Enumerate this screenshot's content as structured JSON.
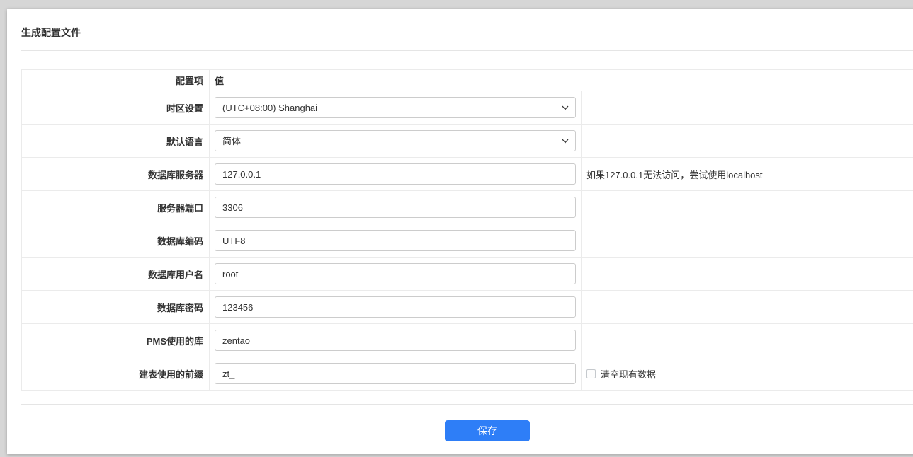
{
  "page": {
    "title": "生成配置文件"
  },
  "colors": {
    "primary_button": "#2e7ef7",
    "page_background": "#d6d6d6",
    "table_border": "#ebebeb",
    "input_border": "#cccccc",
    "text": "#333333"
  },
  "table": {
    "header": {
      "config_item": "配置项",
      "value": "值"
    },
    "rows": [
      {
        "label": "时区设置",
        "control": "select",
        "value": "(UTC+08:00) Shanghai"
      },
      {
        "label": "默认语言",
        "control": "select",
        "value": "简体"
      },
      {
        "label": "数据库服务器",
        "control": "input",
        "value": "127.0.0.1",
        "hint": "如果127.0.0.1无法访问，尝试使用localhost"
      },
      {
        "label": "服务器端口",
        "control": "input",
        "value": "3306"
      },
      {
        "label": "数据库编码",
        "control": "input",
        "value": "UTF8"
      },
      {
        "label": "数据库用户名",
        "control": "input",
        "value": "root"
      },
      {
        "label": "数据库密码",
        "control": "input",
        "value": "123456"
      },
      {
        "label": "PMS使用的库",
        "control": "input",
        "value": "zentao"
      },
      {
        "label": "建表使用的前缀",
        "control": "input",
        "value": "zt_",
        "checkbox": {
          "label": "清空现有数据",
          "checked": false
        }
      }
    ]
  },
  "actions": {
    "save_label": "保存"
  }
}
